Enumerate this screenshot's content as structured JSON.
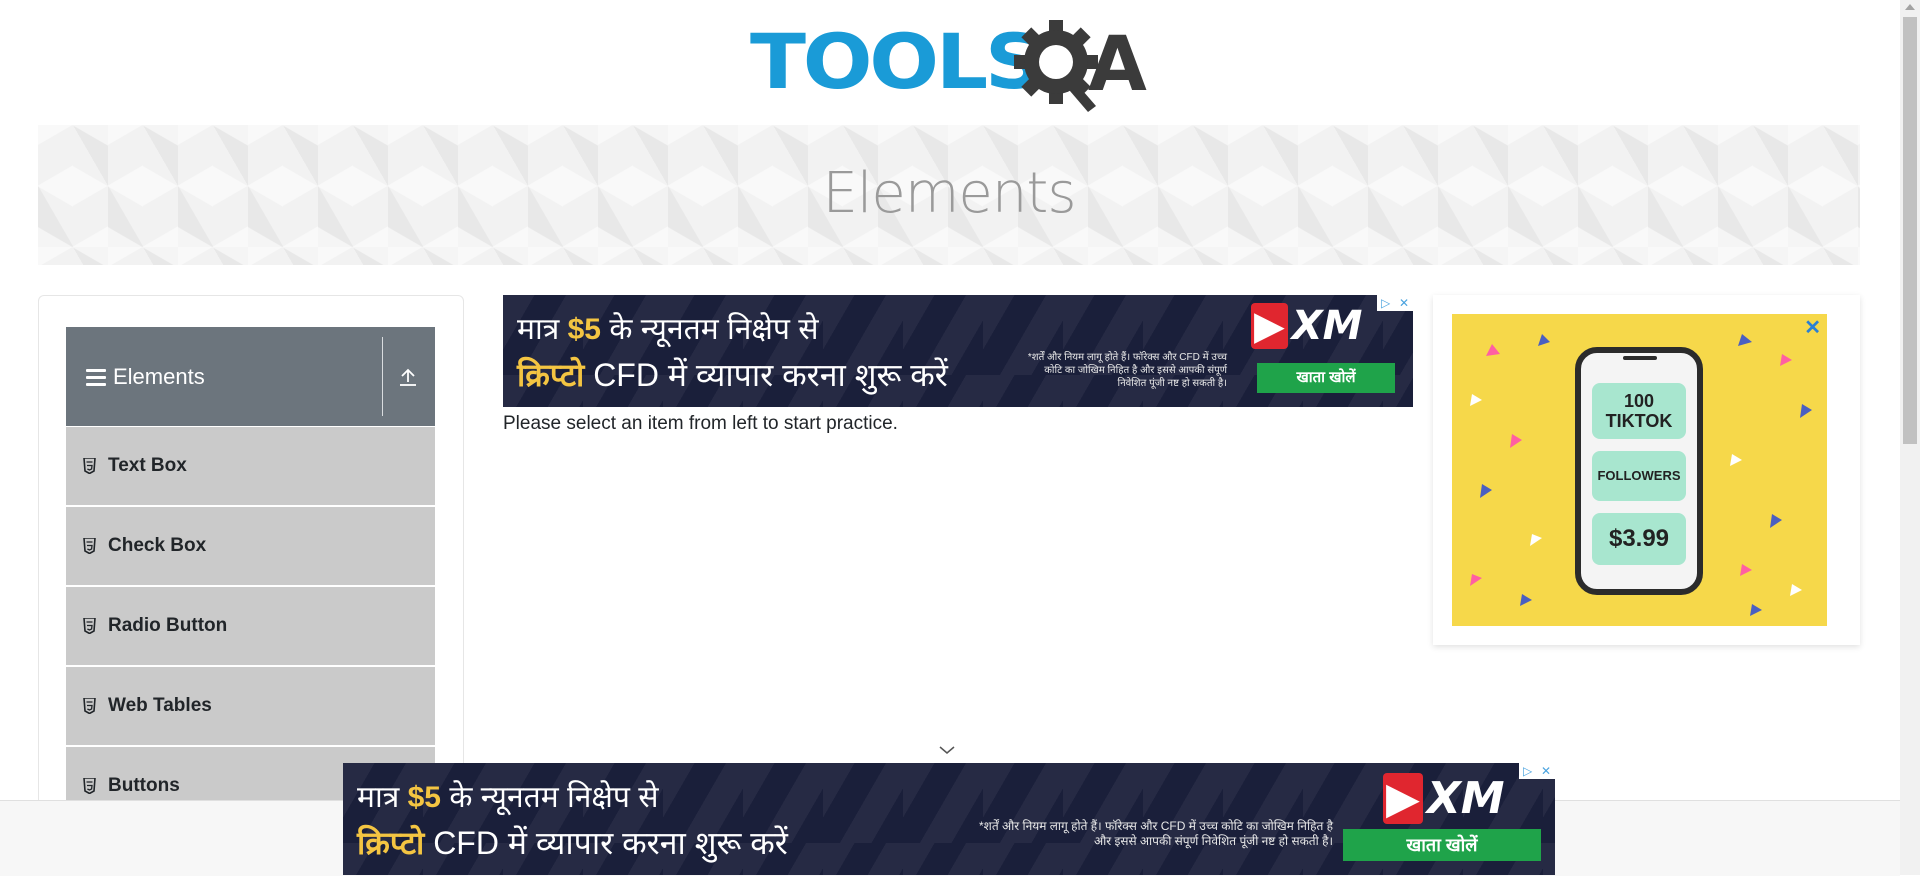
{
  "logo": {
    "text_primary": "TOOLS",
    "text_secondary": "A",
    "alt": "TOOLSQA"
  },
  "banner": {
    "title": "Elements"
  },
  "sidebar": {
    "group_title": "Elements",
    "items": [
      {
        "label": "Text Box"
      },
      {
        "label": "Check Box"
      },
      {
        "label": "Radio Button"
      },
      {
        "label": "Web Tables"
      },
      {
        "label": "Buttons"
      }
    ]
  },
  "ad_banner": {
    "line1_pre": "मात्र ",
    "line1_amount": "$5",
    "line1_post": " के न्यूनतम निक्षेप से",
    "line2_highlight": "क्रिप्टो",
    "line2_post": " CFD में व्यापार करना शुरू करें",
    "fine_print_top": "*शर्तें और नियम लागू होते हैं। फॉरेक्स और CFD में उच्च कोटि का जोखिम निहित है और इससे आपकी संपूर्ण निवेशित पूंजी नष्ट हो सकती है।",
    "brand": "XM",
    "cta": "खाता खोलें"
  },
  "main": {
    "helper_text": "Please select an item from left to start practice."
  },
  "side_ad": {
    "tile1": "100 TIKTOK",
    "tile2": "FOLLOWERS",
    "tile3": "$3.99",
    "close": "✕"
  },
  "colors": {
    "logo_blue": "#1a9bd7",
    "logo_dark": "#3b3b3b",
    "group_header_bg": "#6c757d",
    "menu_item_bg": "#cacaca",
    "ad_bg": "#1a1f3a",
    "ad_cta": "#1fa34a",
    "side_ad_bg": "#f6d84a"
  }
}
